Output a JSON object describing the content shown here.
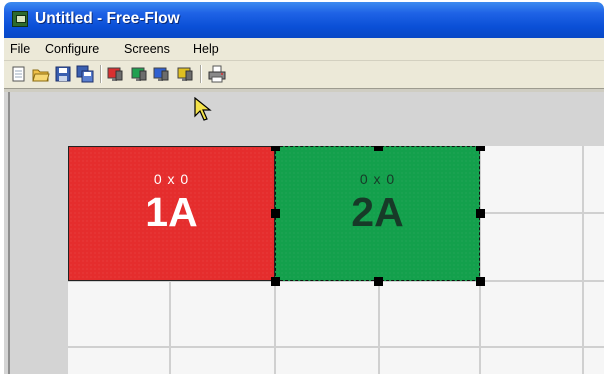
{
  "window": {
    "title": "Untitled - Free-Flow"
  },
  "menu": [
    "File",
    "Configure",
    "Screens",
    "Help"
  ],
  "toolbar": {
    "buttons": [
      {
        "name": "new-icon"
      },
      {
        "name": "open-folder-icon"
      },
      {
        "name": "save-icon"
      },
      {
        "name": "save-as-icon"
      },
      {
        "name": "red-screen-icon",
        "color": "#d83030"
      },
      {
        "name": "green-screen-icon",
        "color": "#20a050"
      },
      {
        "name": "blue-screen-icon",
        "color": "#3060d0"
      },
      {
        "name": "yellow-screen-icon",
        "color": "#e0c020"
      },
      {
        "name": "print-icon"
      }
    ]
  },
  "screens": [
    {
      "resolution": "0 x 0",
      "id": "1A",
      "color": "#e52d2d",
      "selected": false
    },
    {
      "resolution": "0 x 0",
      "id": "2A",
      "color": "#13a04c",
      "selected": true
    }
  ]
}
